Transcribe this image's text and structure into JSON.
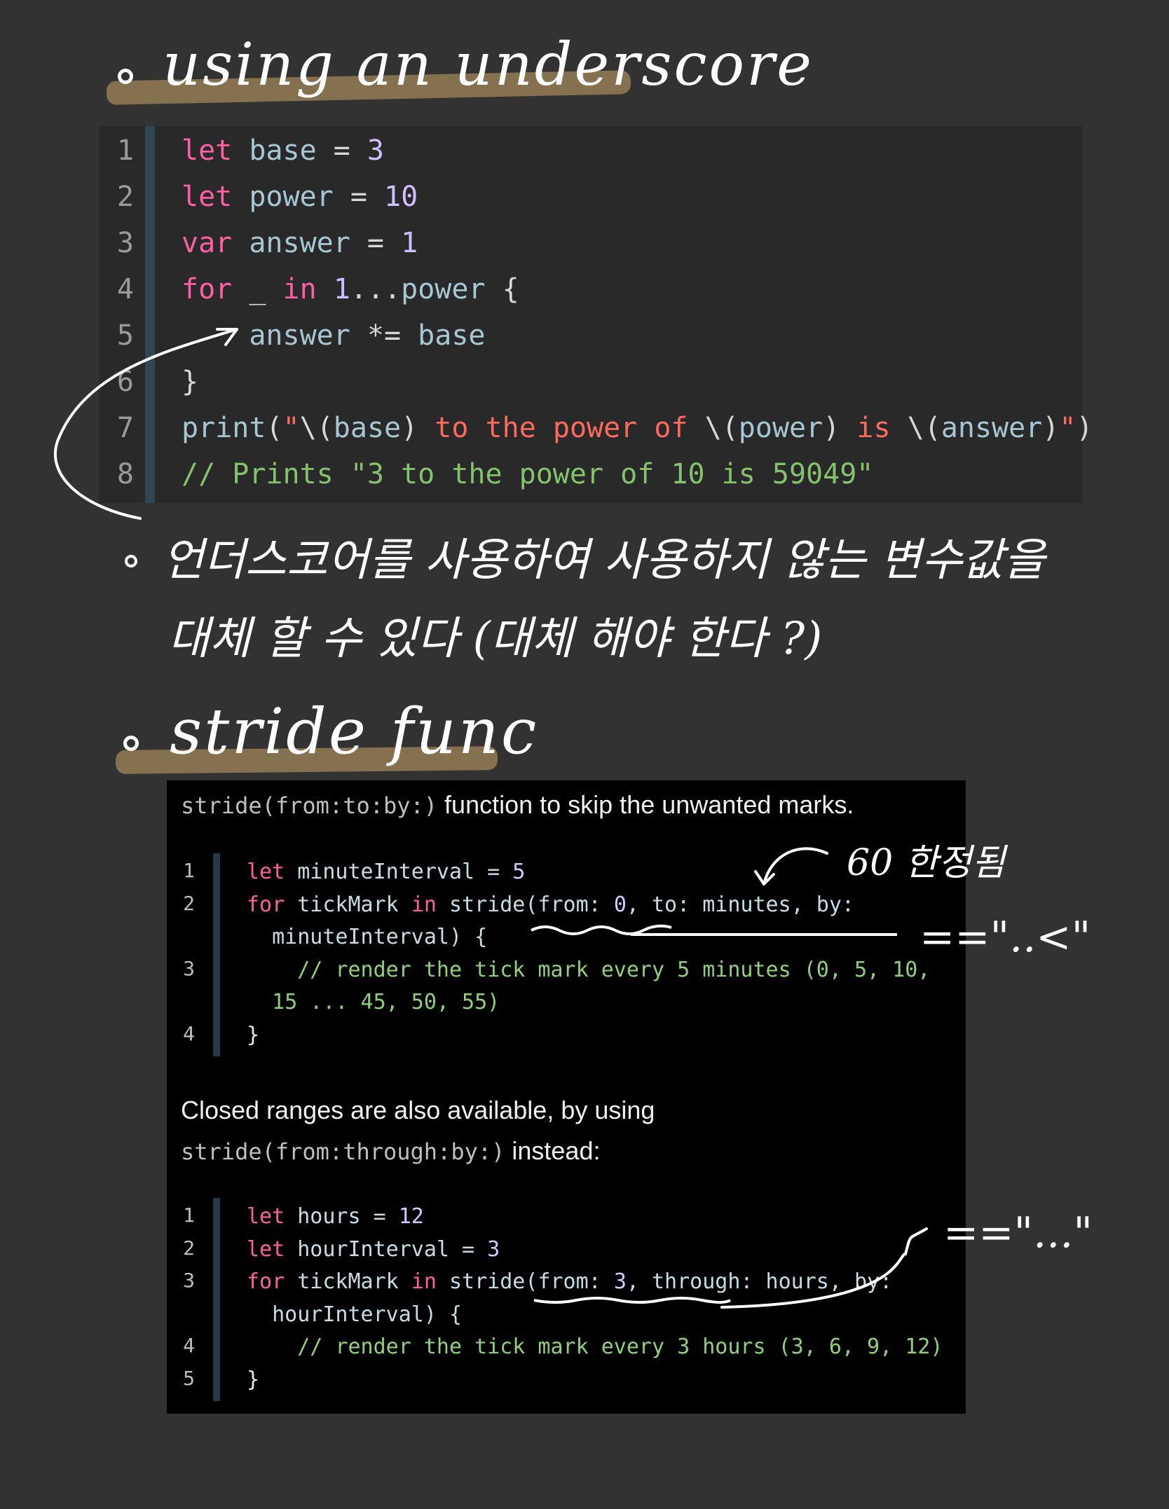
{
  "heading1": "using an underscore",
  "code1": {
    "lines": [
      {
        "n": "1",
        "parts": [
          [
            "let",
            "kw"
          ],
          [
            " ",
            "op"
          ],
          [
            "base",
            "var"
          ],
          [
            " = ",
            "op"
          ],
          [
            "3",
            "num"
          ]
        ]
      },
      {
        "n": "2",
        "parts": [
          [
            "let",
            "kw"
          ],
          [
            " ",
            "op"
          ],
          [
            "power",
            "var"
          ],
          [
            " = ",
            "op"
          ],
          [
            "10",
            "num"
          ]
        ]
      },
      {
        "n": "3",
        "parts": [
          [
            "var",
            "kw"
          ],
          [
            " ",
            "op"
          ],
          [
            "answer",
            "var"
          ],
          [
            " = ",
            "op"
          ],
          [
            "1",
            "num"
          ]
        ]
      },
      {
        "n": "4",
        "parts": [
          [
            "for",
            "kw"
          ],
          [
            " _ ",
            "op"
          ],
          [
            "in",
            "kw"
          ],
          [
            " ",
            "op"
          ],
          [
            "1",
            "num"
          ],
          [
            "...",
            "op"
          ],
          [
            "power",
            "var"
          ],
          [
            " {",
            "op"
          ]
        ]
      },
      {
        "n": "5",
        "parts": [
          [
            "    ",
            "op"
          ],
          [
            "answer",
            "var"
          ],
          [
            " *= ",
            "op"
          ],
          [
            "base",
            "var"
          ]
        ]
      },
      {
        "n": "6",
        "parts": [
          [
            "}",
            "op"
          ]
        ]
      },
      {
        "n": "7",
        "parts": [
          [
            "print",
            "fn"
          ],
          [
            "(",
            "op"
          ],
          [
            "\"",
            "str"
          ],
          [
            "\\(",
            "op"
          ],
          [
            "base",
            "var"
          ],
          [
            ")",
            "op"
          ],
          [
            " to the power of ",
            "str"
          ],
          [
            "\\(",
            "op"
          ],
          [
            "power",
            "var"
          ],
          [
            ")",
            "op"
          ],
          [
            " is ",
            "str"
          ],
          [
            "\\(",
            "op"
          ],
          [
            "answer",
            "var"
          ],
          [
            ")",
            "op"
          ],
          [
            "\"",
            "str"
          ],
          [
            ")",
            "op"
          ]
        ]
      },
      {
        "n": "8",
        "parts": [
          [
            "// Prints \"3 to the power of 10 is 59049\"",
            "cm"
          ]
        ]
      }
    ]
  },
  "note1_line1": "언더스코어를 사용하여 사용하지 않는 변수값을",
  "note1_line2": "대체 할 수 있다 (대체 해야 한다 ?)",
  "heading2": "stride func",
  "doc": {
    "intro_code": "stride(from:to:by:)",
    "intro_text": " function to skip the unwanted marks.",
    "block1": [
      {
        "n": "1",
        "parts": [
          [
            "let",
            "dkw"
          ],
          [
            " minuteInterval = ",
            "dvar"
          ],
          [
            "5",
            "dnum"
          ]
        ]
      },
      {
        "n": "2",
        "parts": [
          [
            "for",
            "dkw"
          ],
          [
            " tickMark ",
            "dvar"
          ],
          [
            "in",
            "dkw"
          ],
          [
            " stride(from: ",
            "dvar"
          ],
          [
            "0",
            "dnum"
          ],
          [
            ", to: minutes, by:",
            "dvar"
          ]
        ]
      },
      {
        "n": "",
        "parts": [
          [
            "  minuteInterval) {",
            "dvar"
          ]
        ]
      },
      {
        "n": "3",
        "parts": [
          [
            "    // render the tick mark every 5 minutes (0, 5, 10,",
            "dcm"
          ]
        ]
      },
      {
        "n": "",
        "parts": [
          [
            "  15 ... 45, 50, 55)",
            "dcm"
          ]
        ]
      },
      {
        "n": "4",
        "parts": [
          [
            "}",
            "dplain"
          ]
        ]
      }
    ],
    "mid_text": "Closed ranges are also available, by using",
    "mid_code": "stride(from:through:by:)",
    "mid_text2": " instead:",
    "block2": [
      {
        "n": "1",
        "parts": [
          [
            "let",
            "dkw"
          ],
          [
            " hours = ",
            "dvar"
          ],
          [
            "12",
            "dnum"
          ]
        ]
      },
      {
        "n": "2",
        "parts": [
          [
            "let",
            "dkw"
          ],
          [
            " hourInterval = ",
            "dvar"
          ],
          [
            "3",
            "dnum"
          ]
        ]
      },
      {
        "n": "3",
        "parts": [
          [
            "for",
            "dkw"
          ],
          [
            " tickMark ",
            "dvar"
          ],
          [
            "in",
            "dkw"
          ],
          [
            " stride(from: ",
            "dvar"
          ],
          [
            "3",
            "dnum"
          ],
          [
            ", through: hours, by:",
            "dvar"
          ]
        ]
      },
      {
        "n": "",
        "parts": [
          [
            "  hourInterval) {",
            "dvar"
          ]
        ]
      },
      {
        "n": "4",
        "parts": [
          [
            "    // render the tick mark every 3 hours (3, 6, 9, 12)",
            "dcm"
          ]
        ]
      },
      {
        "n": "5",
        "parts": [
          [
            "}",
            "dplain"
          ]
        ]
      }
    ]
  },
  "annotation_60": "60 한정됨",
  "annotation_eq1": "==\"..<\"",
  "annotation_eq2": "==\"...\""
}
